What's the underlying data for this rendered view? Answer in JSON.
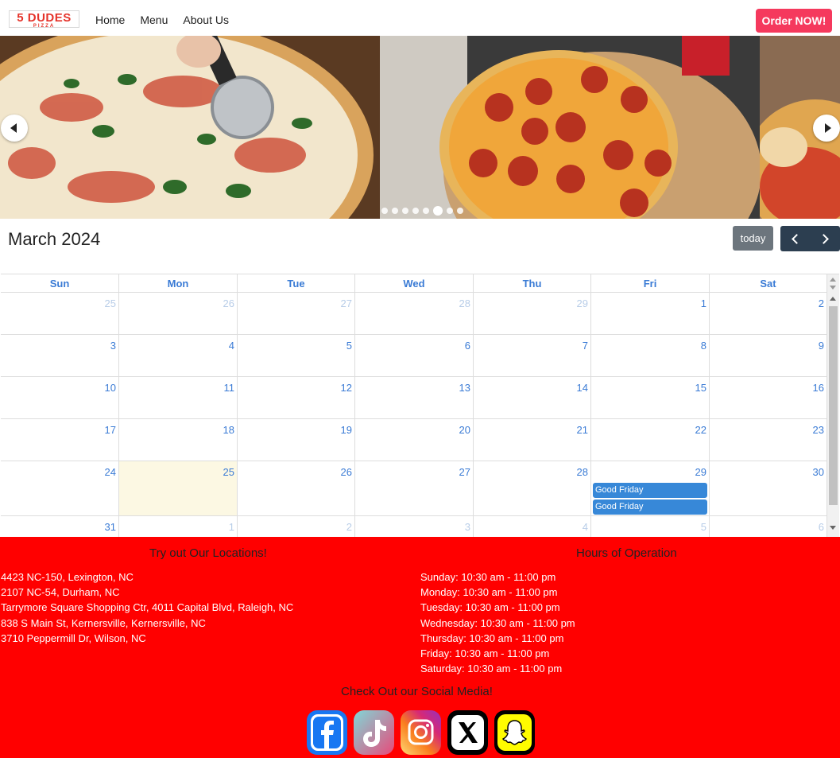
{
  "brand": {
    "name": "5 DUDES",
    "sub": "PIZZA"
  },
  "nav": {
    "links": [
      "Home",
      "Menu",
      "About Us"
    ],
    "order_label": "Order NOW!"
  },
  "calendar": {
    "title": "March 2024",
    "today_label": "today",
    "days_of_week": [
      "Sun",
      "Mon",
      "Tue",
      "Wed",
      "Thu",
      "Fri",
      "Sat"
    ],
    "weeks": [
      [
        {
          "n": "25",
          "o": true
        },
        {
          "n": "26",
          "o": true
        },
        {
          "n": "27",
          "o": true
        },
        {
          "n": "28",
          "o": true
        },
        {
          "n": "29",
          "o": true
        },
        {
          "n": "1"
        },
        {
          "n": "2"
        }
      ],
      [
        {
          "n": "3"
        },
        {
          "n": "4"
        },
        {
          "n": "5"
        },
        {
          "n": "6"
        },
        {
          "n": "7"
        },
        {
          "n": "8"
        },
        {
          "n": "9"
        }
      ],
      [
        {
          "n": "10"
        },
        {
          "n": "11"
        },
        {
          "n": "12"
        },
        {
          "n": "13"
        },
        {
          "n": "14"
        },
        {
          "n": "15"
        },
        {
          "n": "16"
        }
      ],
      [
        {
          "n": "17"
        },
        {
          "n": "18"
        },
        {
          "n": "19"
        },
        {
          "n": "20"
        },
        {
          "n": "21"
        },
        {
          "n": "22"
        },
        {
          "n": "23"
        }
      ],
      [
        {
          "n": "24"
        },
        {
          "n": "25",
          "today": true
        },
        {
          "n": "26"
        },
        {
          "n": "27"
        },
        {
          "n": "28"
        },
        {
          "n": "29",
          "events": [
            "Good Friday",
            "Good Friday"
          ]
        },
        {
          "n": "30"
        }
      ],
      [
        {
          "n": "31"
        },
        {
          "n": "1",
          "o": true
        },
        {
          "n": "2",
          "o": true
        },
        {
          "n": "3",
          "o": true
        },
        {
          "n": "4",
          "o": true
        },
        {
          "n": "5",
          "o": true
        },
        {
          "n": "6",
          "o": true
        }
      ]
    ]
  },
  "footer": {
    "locations_heading": "Try out Our Locations!",
    "locations": [
      "4423 NC-150, Lexington, NC",
      "2107 NC-54, Durham, NC",
      "Tarrymore Square Shopping Ctr, 4011 Capital Blvd, Raleigh, NC",
      "838 S Main St, Kernersville, Kernersville, NC",
      "3710 Peppermill Dr, Wilson, NC"
    ],
    "hours_heading": "Hours of Operation",
    "hours": [
      "Sunday: 10:30 am - 11:00 pm",
      "Monday: 10:30 am - 11:00 pm",
      "Tuesday: 10:30 am - 11:00 pm",
      "Wednesday: 10:30 am - 11:00 pm",
      "Thursday: 10:30 am - 11:00 pm",
      "Friday: 10:30 am - 11:00 pm",
      "Saturday: 10:30 am - 11:00 pm"
    ],
    "social_heading": "Check Out our Social Media!",
    "social": [
      "facebook-icon",
      "tiktok-icon",
      "instagram-icon",
      "x-icon",
      "snapchat-icon"
    ]
  },
  "colors": {
    "accent": "#f5395d",
    "footer_bg": "#ff0000",
    "calendar_link": "#3a7bd5",
    "event": "#3788d8",
    "today_bg": "#fcf8e3"
  }
}
